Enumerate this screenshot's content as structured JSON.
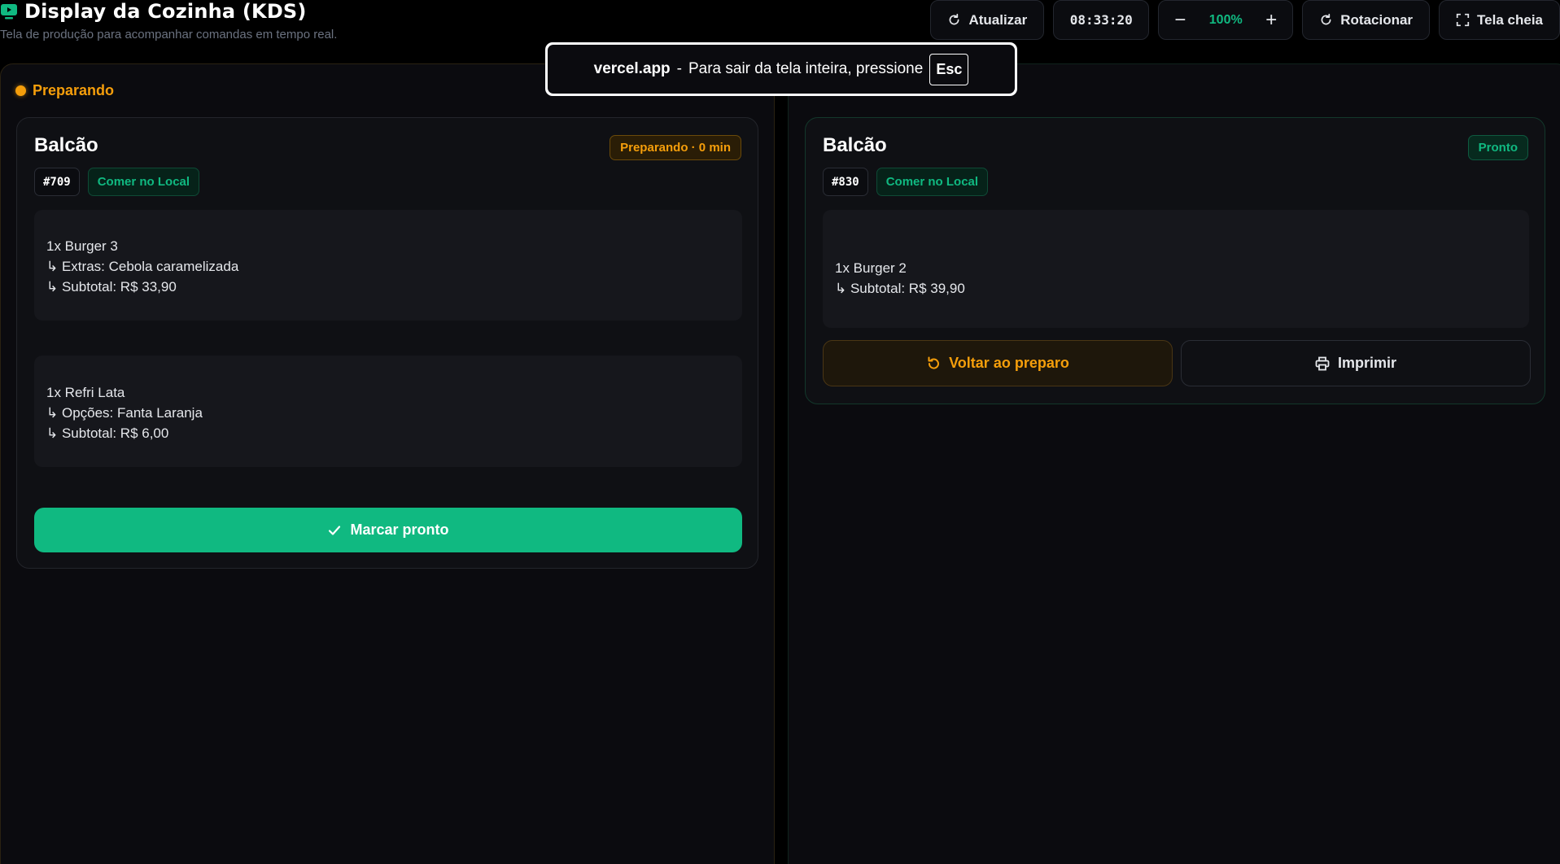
{
  "header": {
    "title": "Display da Cozinha (KDS)",
    "subtitle": "Tela de produção para acompanhar comandas em tempo real.",
    "app_icon": "monitor-icon",
    "toolbar": {
      "refresh_label": "Atualizar",
      "clock": "08:33:20",
      "zoom_minus": "−",
      "zoom_value": "100%",
      "zoom_plus": "+",
      "rotate_label": "Rotacionar",
      "fullscreen_label": "Tela cheia"
    }
  },
  "fullscreen_notice": {
    "host": "vercel.app",
    "separator": "-",
    "message": "Para sair da tela inteira, pressione",
    "key": "Esc"
  },
  "columns": {
    "preparing": {
      "label": "Preparando",
      "color": "#f59e0b",
      "order": {
        "title": "Balcão",
        "status": "Preparando · 0 min",
        "number": "#709",
        "type": "Comer no Local",
        "items": [
          {
            "name": "1x Burger 3",
            "details": [
              "↳ Extras: Cebola caramelizada",
              "↳ Subtotal: R$ 33,90"
            ]
          },
          {
            "name": "1x Refri Lata",
            "details": [
              "↳ Opções: Fanta Laranja",
              "↳ Subtotal: R$ 6,00"
            ]
          }
        ],
        "action_label": "Marcar pronto"
      }
    },
    "ready": {
      "order": {
        "title": "Balcão",
        "status": "Pronto",
        "number": "#830",
        "type": "Comer no Local",
        "items": [
          {
            "name": "1x Burger 2",
            "details": [
              "↳ Subtotal: R$ 39,90"
            ]
          }
        ],
        "back_label": "Voltar ao preparo",
        "print_label": "Imprimir"
      }
    }
  },
  "colors": {
    "accent_green": "#10b981",
    "accent_amber": "#f59e0b",
    "background": "#000000"
  }
}
